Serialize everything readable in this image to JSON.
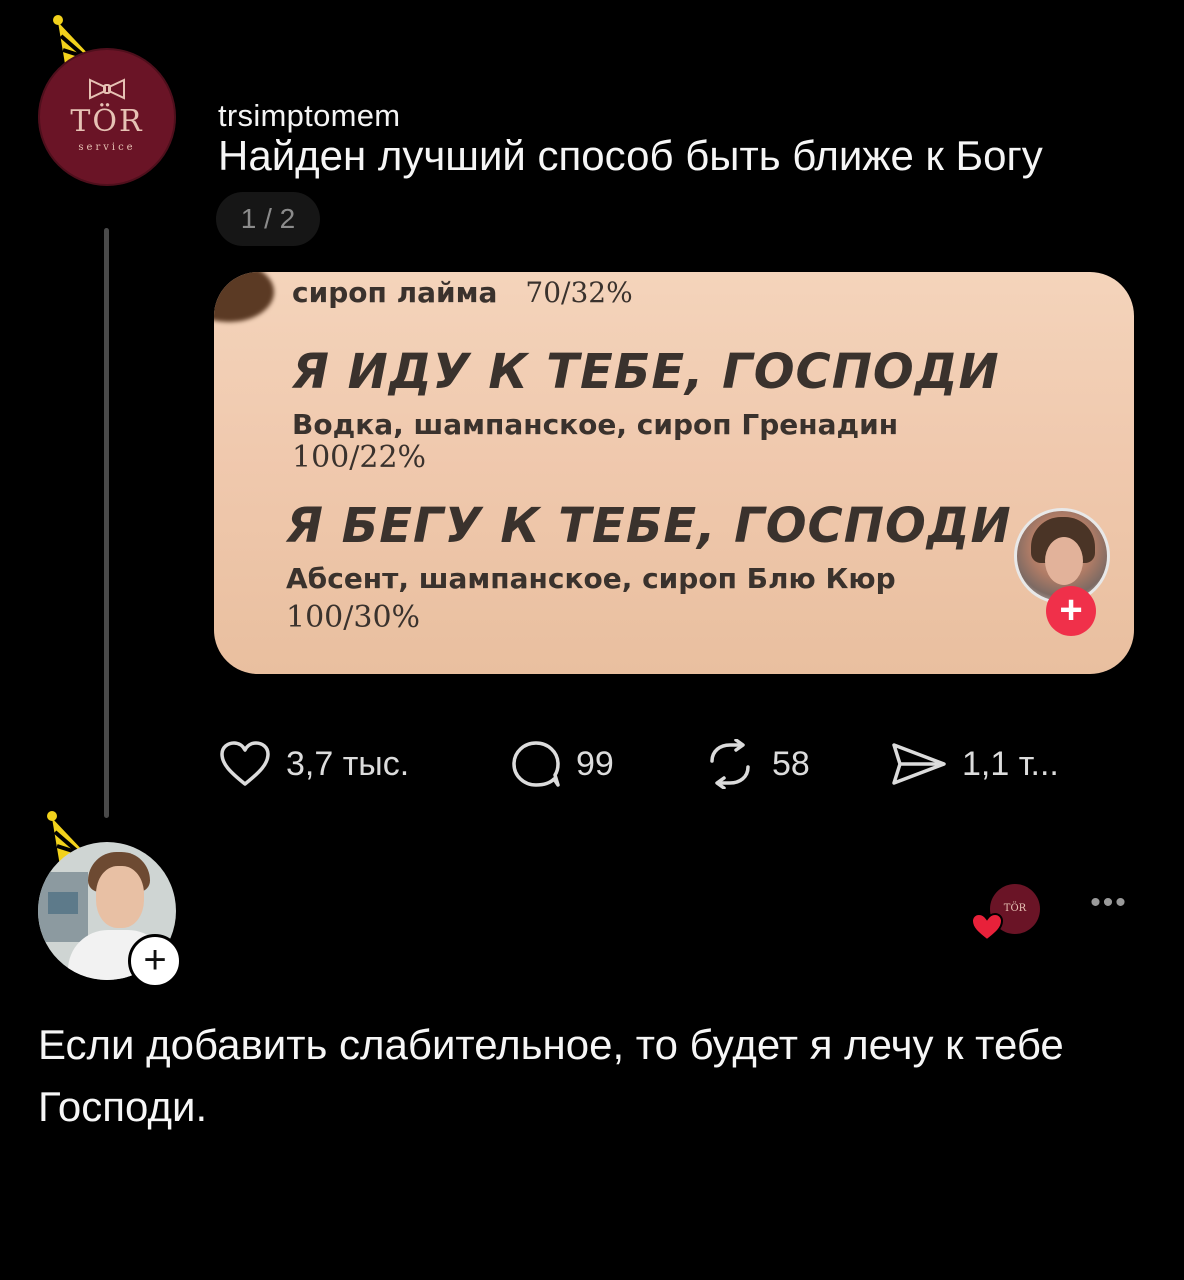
{
  "post": {
    "avatar": {
      "logo_text": "ТÖR",
      "sub_text": "service"
    },
    "username": "trsimptomem",
    "text": "Найден лучший способ быть ближе к Богу",
    "page_indicator": "1 / 2",
    "media": {
      "line_top_name": "сироп лайма",
      "line_top_nums": "70/32%",
      "heading_1": "Я ИДУ К ТЕБЕ, ГОСПОДИ",
      "desc_1": "Водка, шампанское, сироп Гренадин",
      "nums_1": "100/22%",
      "heading_2": "Я БЕГУ К ТЕБЕ, ГОСПОДИ",
      "desc_2": "Абсент, шампанское, сироп Блю Кюр",
      "nums_2": "100/30%"
    },
    "actions": {
      "likes": "3,7 тыс.",
      "comments": "99",
      "reposts": "58",
      "shares": "1,1 т..."
    }
  },
  "reply": {
    "text": "Если добавить слабительное, то будет я лечу к тебе Господи.",
    "mini_avatar_text": "ТÖR",
    "more_label": "•••"
  },
  "icons": {
    "party_hat": "party-hat-icon",
    "heart": "heart-icon",
    "comment": "comment-icon",
    "repost": "repost-icon",
    "share": "share-icon",
    "plus": "plus-icon"
  },
  "colors": {
    "background": "#000000",
    "brand_avatar": "#6a1426",
    "follow_red": "#f0304a",
    "liked_heart": "#e8213a"
  }
}
